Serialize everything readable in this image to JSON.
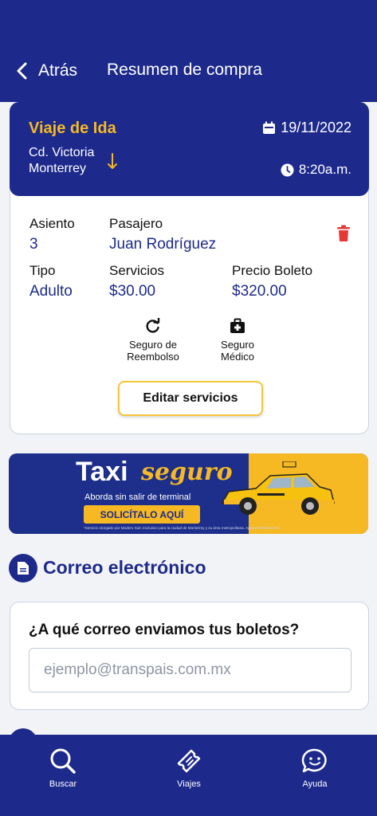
{
  "header": {
    "back_label": "Atrás",
    "title": "Resumen de compra"
  },
  "trip": {
    "type": "Viaje de Ida",
    "date": "19/11/2022",
    "origin": "Cd. Victoria",
    "destination": "Monterrey",
    "time": "8:20a.m."
  },
  "passenger": {
    "seat_label": "Asiento",
    "seat": "3",
    "name_label": "Pasajero",
    "name": "Juan Rodríguez",
    "type_label": "Tipo",
    "type": "Adulto",
    "services_label": "Servicios",
    "services": "$30.00",
    "price_label": "Precio Boleto",
    "price": "$320.00"
  },
  "services": [
    {
      "line1": "Seguro de",
      "line2": "Reembolso",
      "icon": "refresh-icon"
    },
    {
      "line1": "Seguro",
      "line2": "Médico",
      "icon": "medical-kit-icon"
    }
  ],
  "edit_services_label": "Editar servicios",
  "banner": {
    "word1": "Taxi",
    "word2": "seguro",
    "subtitle": "Aborda sin salir de terminal",
    "cta": "SOLICÍTALO AQUÍ",
    "fine_print": "*Servicio otorgado por Modero Suit; exclusivo para la ciudad de Monterrey y su área metropolitana. Aplican restricciones."
  },
  "email_section": {
    "title": "Correo electrónico",
    "question": "¿A qué correo enviamos tus boletos?",
    "placeholder": "ejemplo@transpais.com.mx",
    "value": ""
  },
  "tabs": [
    {
      "label": "Buscar",
      "icon": "search-icon"
    },
    {
      "label": "Viajes",
      "icon": "ticket-icon"
    },
    {
      "label": "Ayuda",
      "icon": "chat-smile-icon"
    }
  ],
  "colors": {
    "primary": "#1d2a8c",
    "accent": "#f6b923",
    "danger": "#e53935"
  }
}
